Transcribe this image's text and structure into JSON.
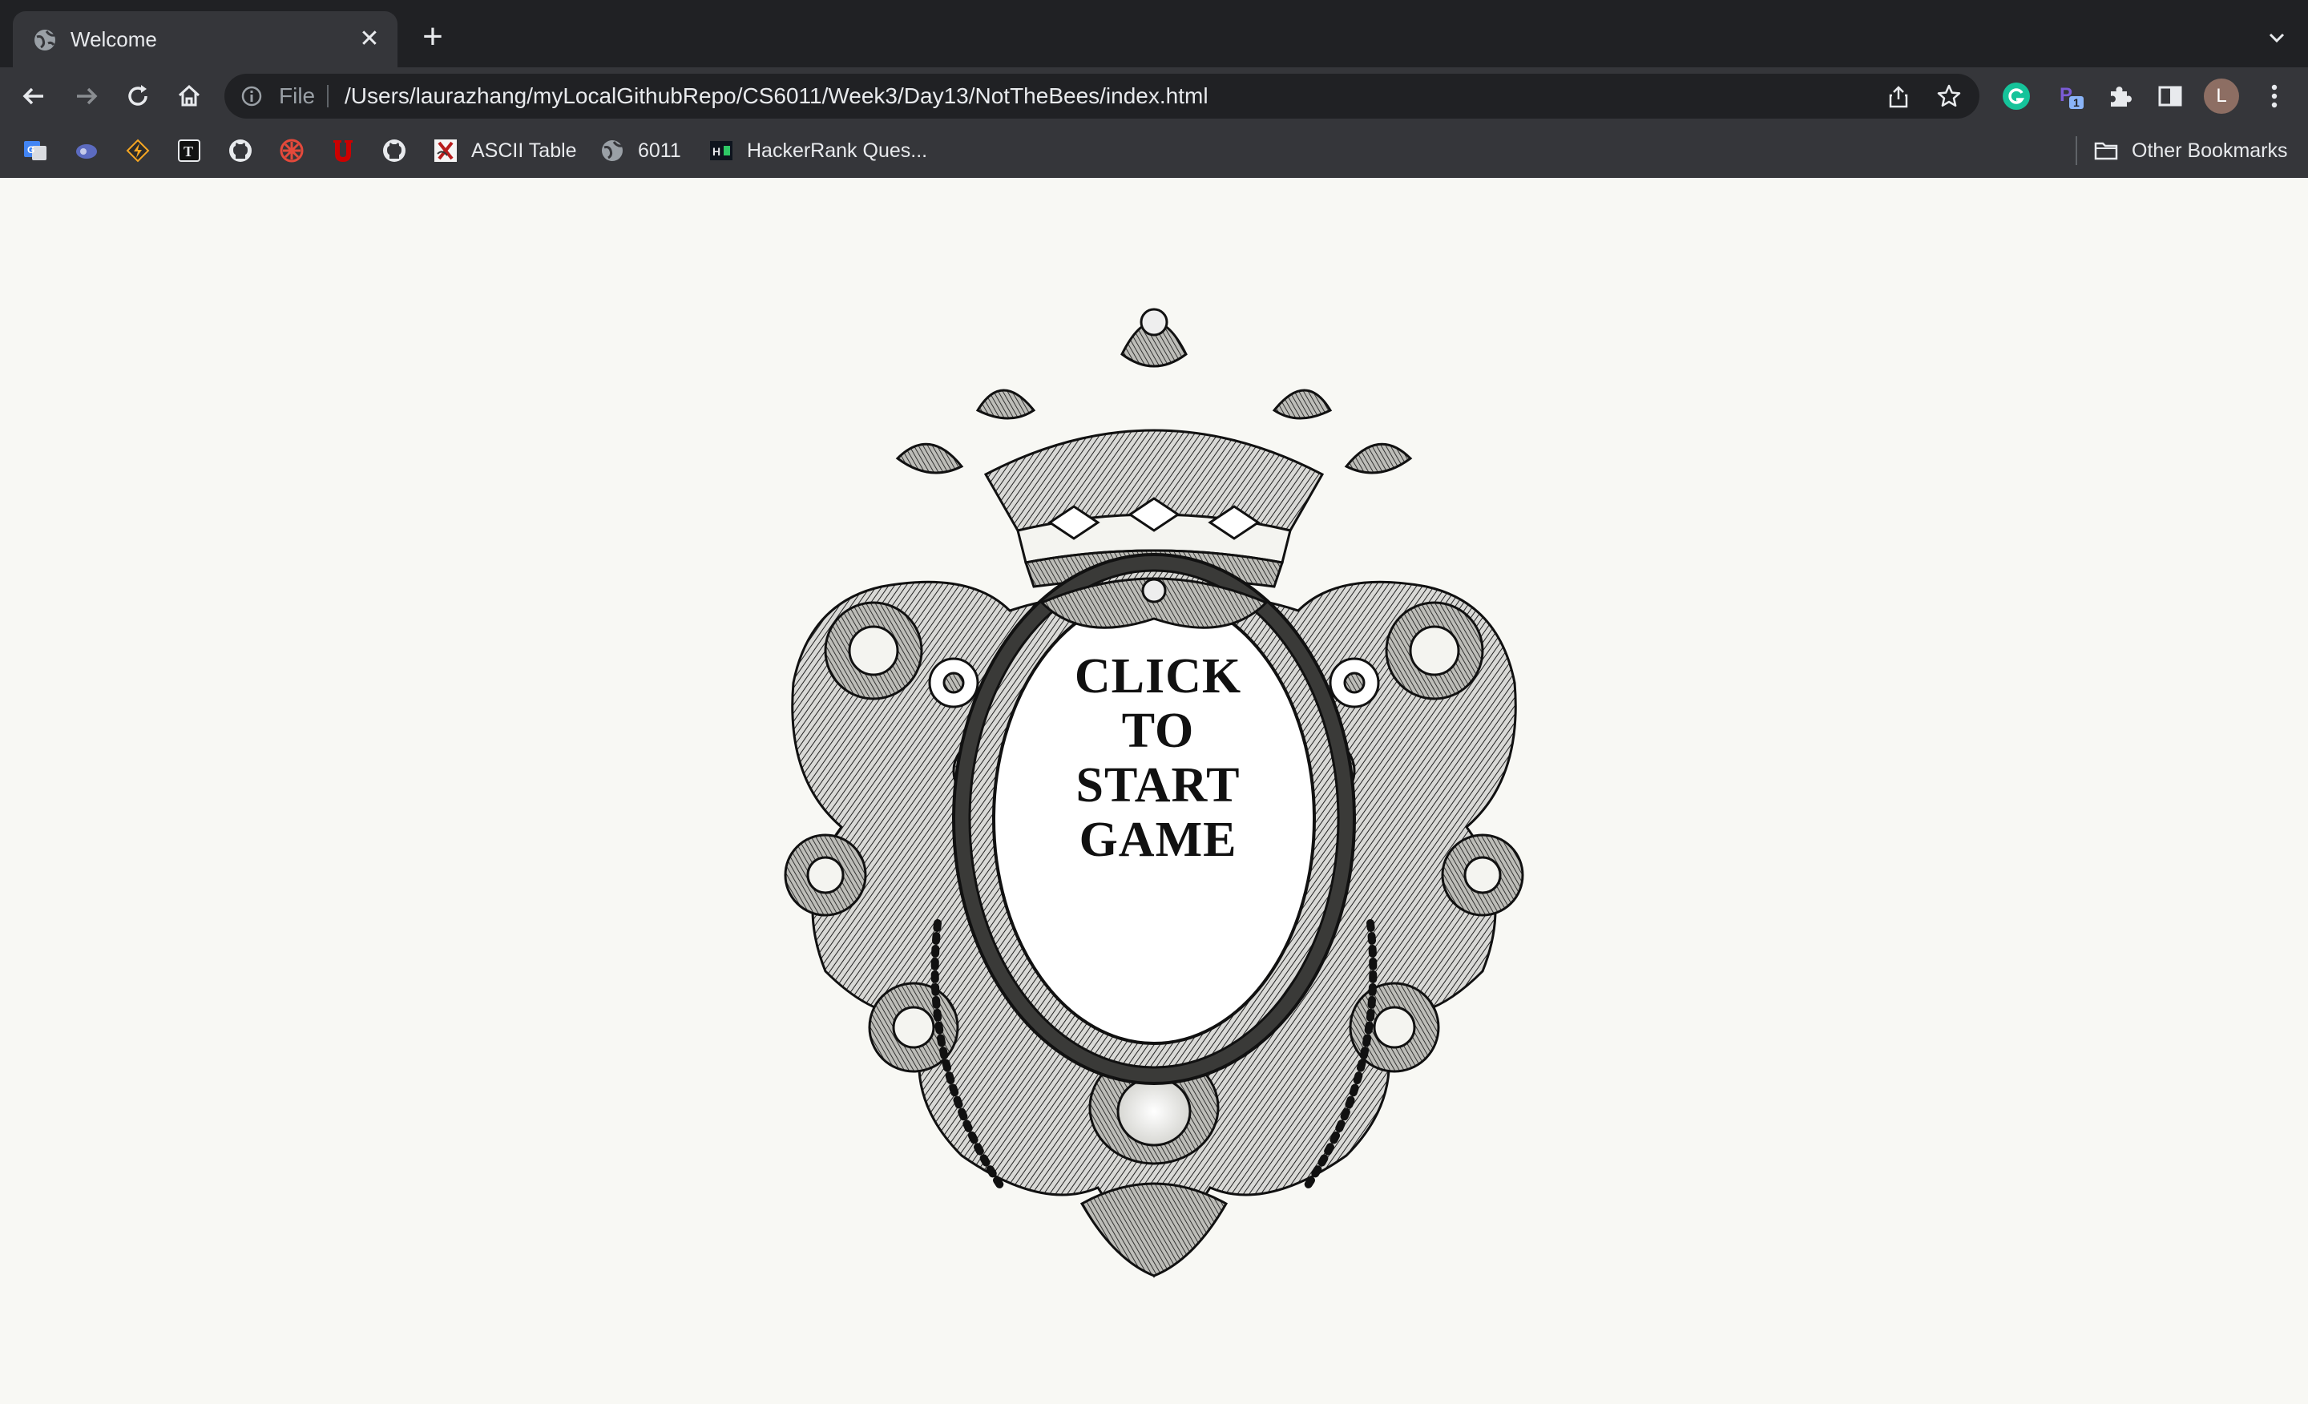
{
  "browser": {
    "tab": {
      "title": "Welcome",
      "close_glyph": "✕",
      "icon": "globe-icon"
    },
    "new_tab_glyph": "+",
    "omnibox": {
      "scheme": "File",
      "url": "/Users/laurazhang/myLocalGithubRepo/CS6011/Week3/Day13/NotTheBees/index.html"
    },
    "profile_initial": "L",
    "bookmarks": [
      {
        "label": "",
        "icon": "google-translate-icon"
      },
      {
        "label": "",
        "icon": "extension-icon"
      },
      {
        "label": "",
        "icon": "bolt-icon"
      },
      {
        "label": "",
        "icon": "typora-icon"
      },
      {
        "label": "",
        "icon": "github-icon"
      },
      {
        "label": "",
        "icon": "asterisk-icon"
      },
      {
        "label": "",
        "icon": "u-logo-icon"
      },
      {
        "label": "",
        "icon": "github-icon"
      },
      {
        "label": "ASCII Table",
        "icon": "ascii-table-icon"
      },
      {
        "label": "6011",
        "icon": "globe-icon"
      },
      {
        "label": "HackerRank Ques...",
        "icon": "hackerrank-icon"
      }
    ],
    "other_bookmarks": "Other Bookmarks"
  },
  "page": {
    "start_lines": [
      "CLICK",
      "TO",
      "START",
      "GAME"
    ],
    "colors": {
      "background": "#f8f8f4",
      "ink": "#111111"
    }
  }
}
